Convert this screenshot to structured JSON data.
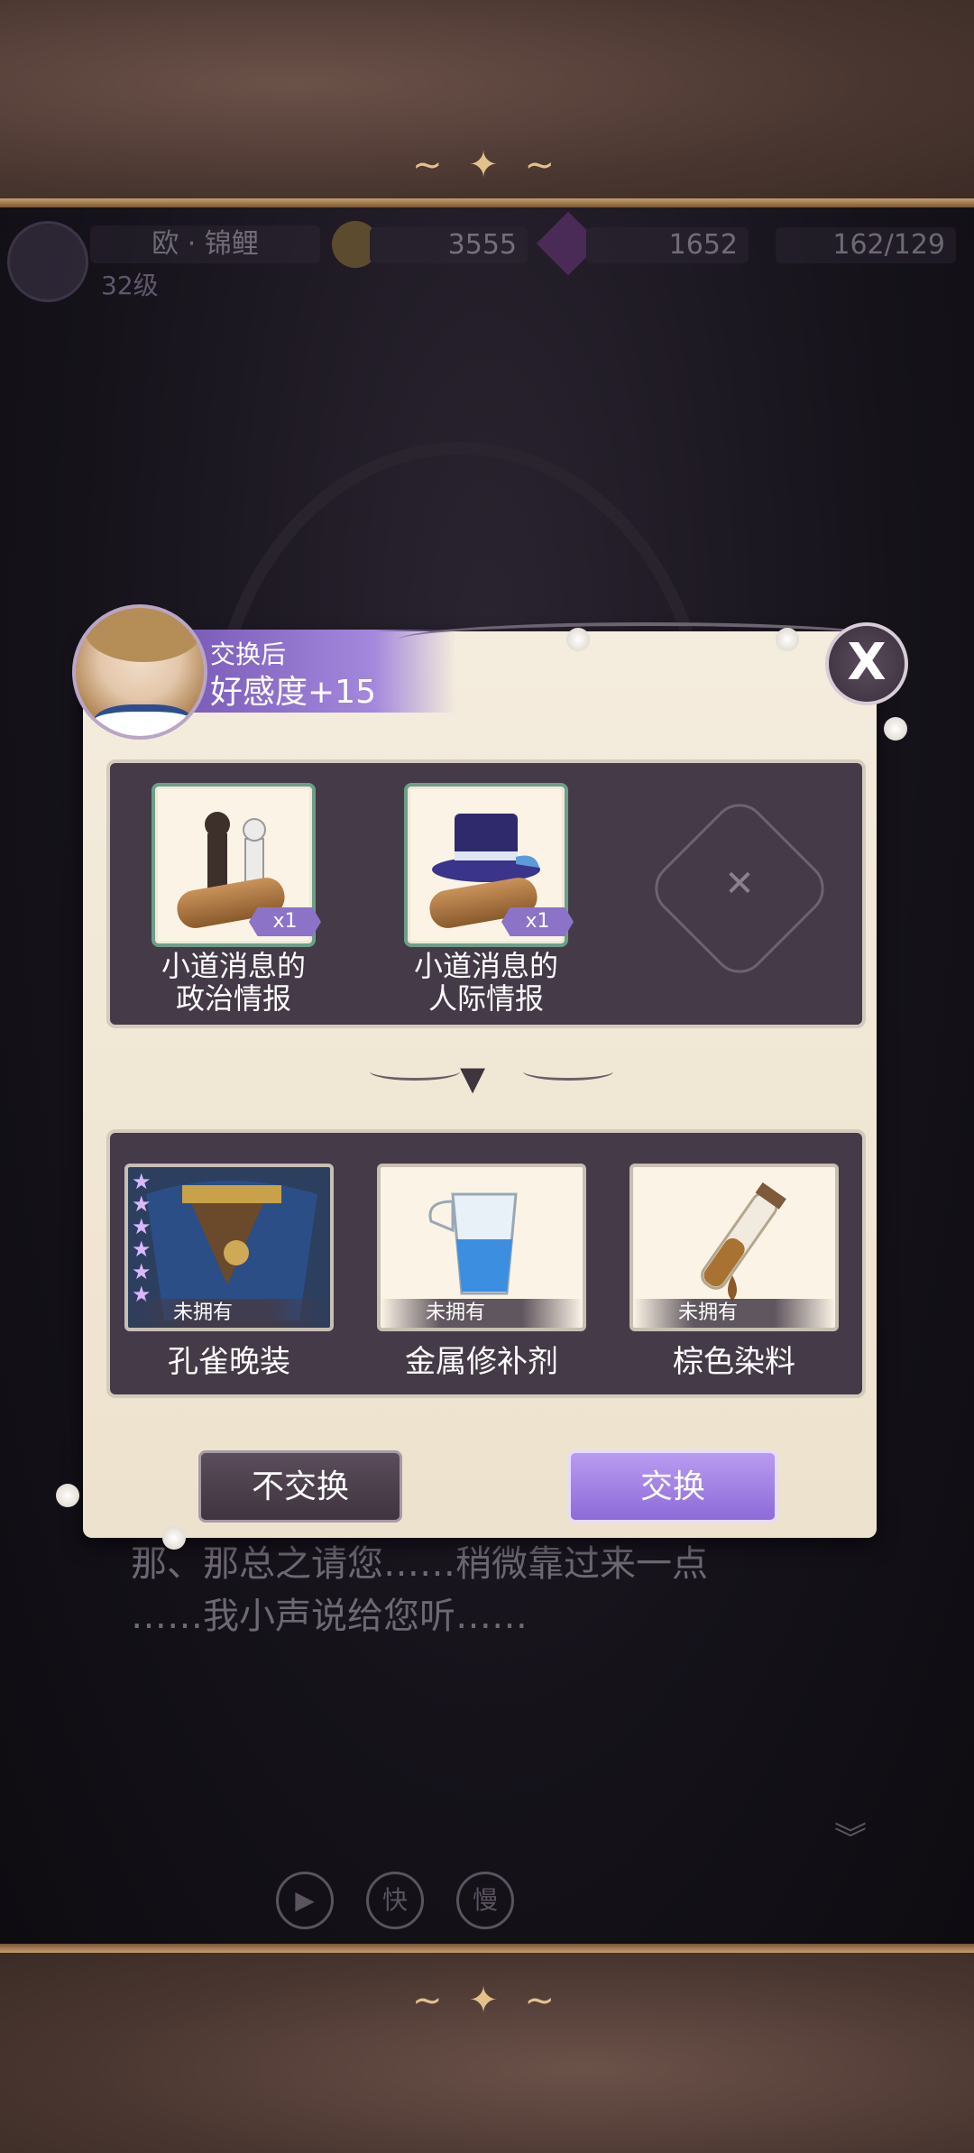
{
  "hud": {
    "player_name": "欧 · 锦鲤",
    "level": "32级",
    "gold": "3555",
    "gems": "1652",
    "stamina": "162/129"
  },
  "dialogue": {
    "line1": "那、那总之请您……稍微靠过来一点",
    "line2": "……我小声说给您听……"
  },
  "controls": {
    "play": "▶",
    "fast": "快",
    "slow": "慢"
  },
  "exchange": {
    "banner_subtitle": "交换后",
    "banner_title": "好感度+15",
    "close_label": "X",
    "give_items": [
      {
        "label_line1": "小道消息的",
        "label_line2": "政治情报",
        "qty": "x1",
        "icon": "chess-pieces-scroll-icon"
      },
      {
        "label_line1": "小道消息的",
        "label_line2": "人际情报",
        "qty": "x1",
        "icon": "top-hat-scroll-icon"
      }
    ],
    "receive_items": [
      {
        "label": "孔雀晚装",
        "status": "未拥有",
        "icon": "peacock-gown-icon"
      },
      {
        "label": "金属修补剂",
        "status": "未拥有",
        "icon": "metal-repair-flask-icon"
      },
      {
        "label": "棕色染料",
        "status": "未拥有",
        "icon": "brown-dye-vial-icon"
      }
    ],
    "decline_button": "不交换",
    "confirm_button": "交换"
  },
  "colors": {
    "accent_purple": "#9b7ee0",
    "panel_bg": "#f4ecdd",
    "box_bg": "#453a47"
  }
}
